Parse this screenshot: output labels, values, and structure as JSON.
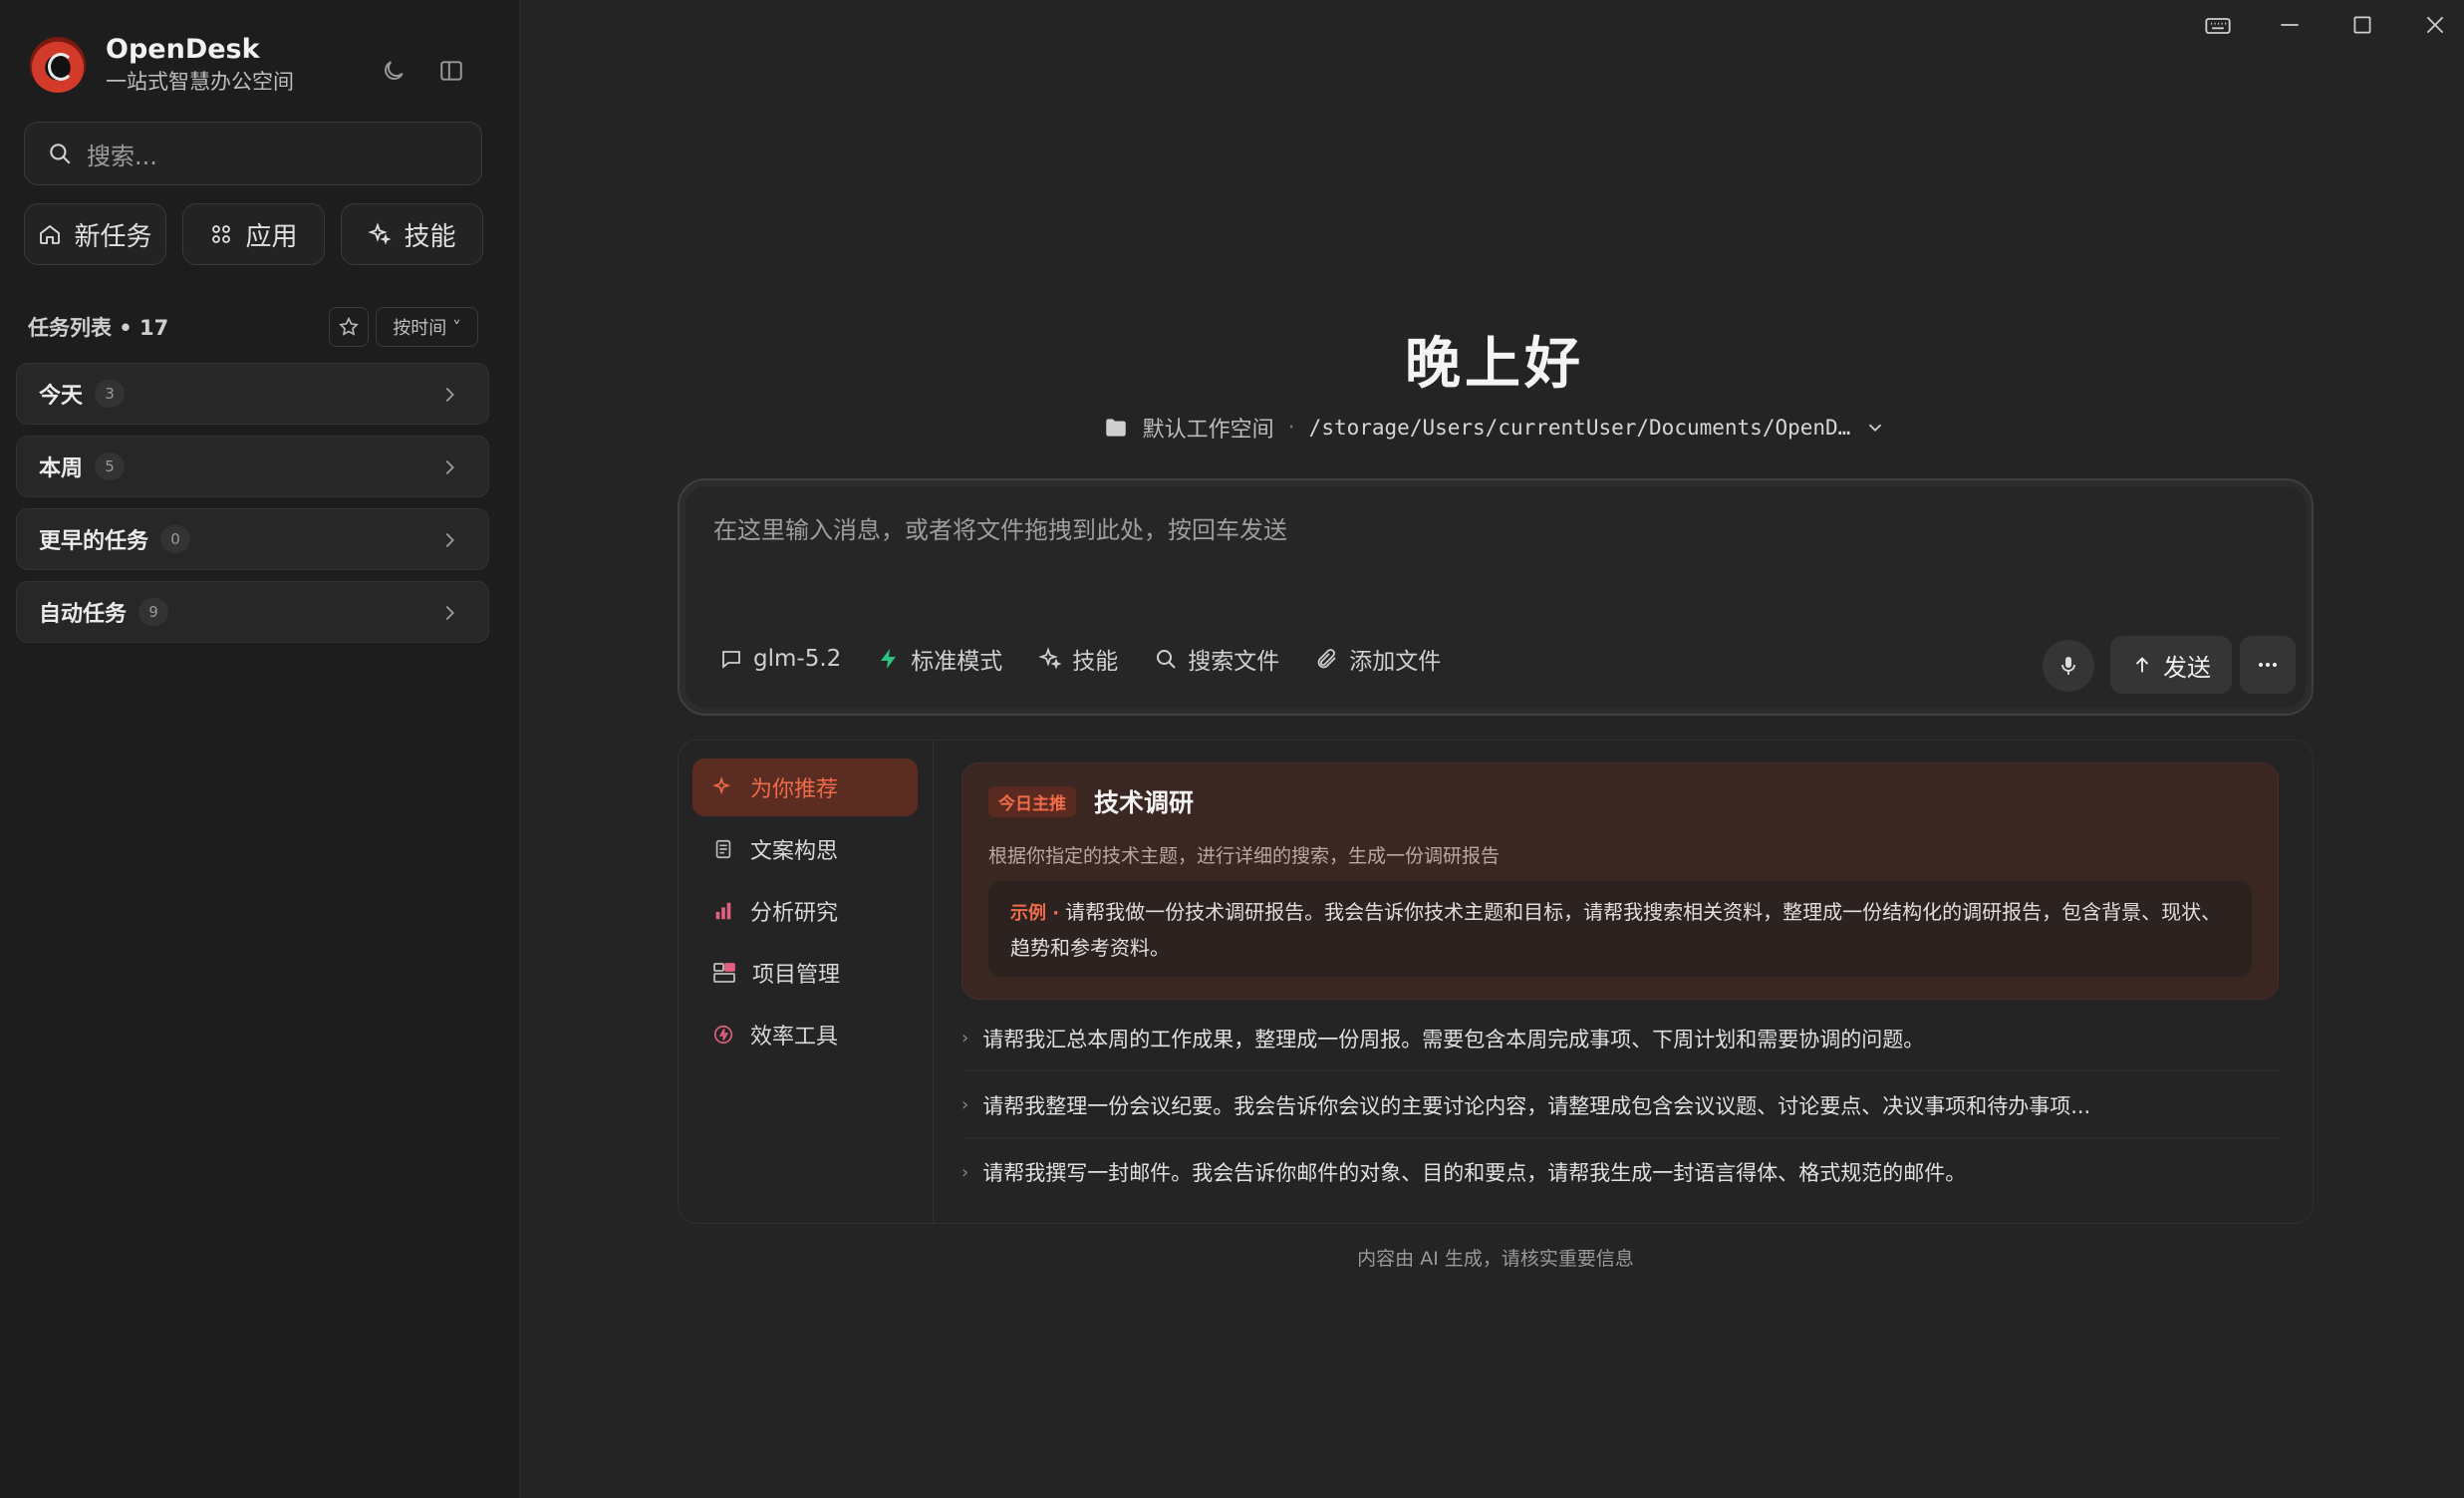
{
  "app": {
    "name": "OpenDesk",
    "tagline": "一站式智慧办公空间"
  },
  "sidebar": {
    "search_placeholder": "搜索...",
    "quick_actions": [
      {
        "label": "新任务",
        "icon": "home-icon"
      },
      {
        "label": "应用",
        "icon": "apps-grid-icon"
      },
      {
        "label": "技能",
        "icon": "sparkle-icon"
      }
    ],
    "task_list_title": "任务列表 • 17",
    "sort_label": "按时间 ˅",
    "groups": [
      {
        "label": "今天",
        "count": "3"
      },
      {
        "label": "本周",
        "count": "5"
      },
      {
        "label": "更早的任务",
        "count": "0"
      },
      {
        "label": "自动任务",
        "count": "9"
      }
    ]
  },
  "main": {
    "greeting": "晚上好",
    "workspace_name": "默认工作空间",
    "workspace_sep": "·",
    "workspace_path": "/storage/Users/currentUser/Documents/OpenD…",
    "composer_placeholder": "在这里输入消息，或者将文件拖拽到此处，按回车发送",
    "toolbar": {
      "model": "glm-5.2",
      "mode": "标准模式",
      "skills": "技能",
      "search_files": "搜索文件",
      "add_file": "添加文件",
      "send": "发送"
    },
    "categories": [
      {
        "label": "为你推荐",
        "icon": "sparkle-icon",
        "active": true
      },
      {
        "label": "文案构思",
        "icon": "document-icon"
      },
      {
        "label": "分析研究",
        "icon": "bar-chart-icon"
      },
      {
        "label": "项目管理",
        "icon": "project-icon"
      },
      {
        "label": "效率工具",
        "icon": "lightning-icon"
      }
    ],
    "featured": {
      "badge": "今日主推",
      "title": "技术调研",
      "desc": "根据你指定的技术主题，进行详细的搜索，生成一份调研报告",
      "example_tag": "示例 ·",
      "example_text": "请帮我做一份技术调研报告。我会告诉你技术主题和目标，请帮我搜索相关资料，整理成一份结构化的调研报告，包含背景、现状、趋势和参考资料。"
    },
    "suggestions": [
      "请帮我汇总本周的工作成果，整理成一份周报。需要包含本周完成事项、下周计划和需要协调的问题。",
      "请帮我整理一份会议纪要。我会告诉你会议的主要讨论内容，请整理成包含会议议题、讨论要点、决议事项和待办事项...",
      "请帮我撰写一封邮件。我会告诉你邮件的对象、目的和要点，请帮我生成一封语言得体、格式规范的邮件。"
    ],
    "footer_note": "内容由 AI 生成，请核实重要信息"
  },
  "colors": {
    "accent": "#f06b4a",
    "background": "#242424",
    "sidebar": "#1d1d1d"
  }
}
